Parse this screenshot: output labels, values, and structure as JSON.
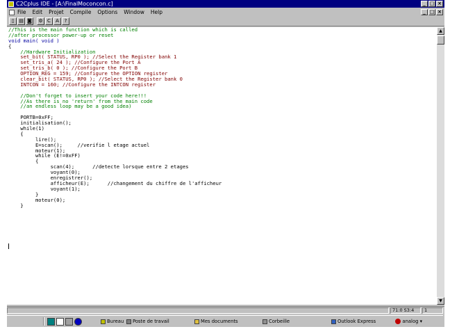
{
  "window": {
    "title": "C2Cplus IDE - [A:\\FinalMoconcon.c]",
    "controls": [
      "_",
      "□",
      "×"
    ]
  },
  "menubar": {
    "items": [
      "File",
      "Edit",
      "Projet",
      "Compile",
      "Options",
      "Window",
      "Help"
    ],
    "mdi_controls": [
      "_",
      "□",
      "×"
    ]
  },
  "toolbar": {
    "buttons": [
      "new",
      "open",
      "save",
      "compile",
      "C",
      "A",
      "?"
    ]
  },
  "editor": {
    "lines": [
      {
        "text": "//This is the main function which is called",
        "kind": "comment"
      },
      {
        "text": "//after processor power-up or reset",
        "kind": "comment"
      },
      {
        "text": "void main( void )",
        "kind": "keyword"
      },
      {
        "text": "{",
        "kind": "plain"
      },
      {
        "text": "    //Hardware Initialization",
        "kind": "comment"
      },
      {
        "text": "    set_bit( STATUS, RP0 ); //Select the Register bank 1",
        "kind": "code"
      },
      {
        "text": "    set_tris_a( 24 ); //Configure the Port A",
        "kind": "code"
      },
      {
        "text": "    set_tris_b( 0 ); //Configure the Port B",
        "kind": "code"
      },
      {
        "text": "    OPTION_REG = 159; //Configure the OPTION register",
        "kind": "code"
      },
      {
        "text": "    clear_bit( STATUS, RP0 ); //Select the Register bank 0",
        "kind": "code"
      },
      {
        "text": "    INTCON = 160; //Configure the INTCON register",
        "kind": "code"
      },
      {
        "text": "",
        "kind": "plain"
      },
      {
        "text": "    //Don't forget to insert your code here!!!",
        "kind": "comment"
      },
      {
        "text": "    //As there is no 'return' from the main code",
        "kind": "comment"
      },
      {
        "text": "    //an endless loop may be a good idea)",
        "kind": "comment"
      },
      {
        "text": "",
        "kind": "plain"
      },
      {
        "text": "    PORTB=0xFF;",
        "kind": "plain"
      },
      {
        "text": "    initialisation();",
        "kind": "plain"
      },
      {
        "text": "    while(1)",
        "kind": "plain"
      },
      {
        "text": "    {",
        "kind": "plain"
      },
      {
        "text": "         lire();",
        "kind": "plain"
      },
      {
        "text": "         E=scan();     //verifie l etage actuel",
        "kind": "plain"
      },
      {
        "text": "         moteur(1);",
        "kind": "plain"
      },
      {
        "text": "         while (E!=0xFF)",
        "kind": "plain"
      },
      {
        "text": "         {",
        "kind": "plain"
      },
      {
        "text": "              scan(4);      //detecte lorsque entre 2 etages",
        "kind": "plain"
      },
      {
        "text": "              voyant(0);",
        "kind": "plain"
      },
      {
        "text": "              enregistrer();",
        "kind": "plain"
      },
      {
        "text": "              afficheur(E);      //changement du chiffre de l'afficheur",
        "kind": "plain"
      },
      {
        "text": "              voyant(1);",
        "kind": "plain"
      },
      {
        "text": "         }",
        "kind": "plain"
      },
      {
        "text": "         moteur(0);",
        "kind": "plain"
      },
      {
        "text": "    }",
        "kind": "plain"
      }
    ]
  },
  "statusbar": {
    "position": "71:0 S3:4",
    "mode": "1"
  },
  "taskbar": {
    "tasks": [
      {
        "label": "Bureau",
        "icon": "desktop-icon"
      },
      {
        "label": "Poste de travail",
        "icon": "computer-icon"
      },
      {
        "label": "Mes documents",
        "icon": "folder-icon"
      },
      {
        "label": "Corbeille",
        "icon": "recycle-bin-icon"
      },
      {
        "label": "Outlook Express",
        "icon": "mail-icon"
      }
    ],
    "tray_label": "analog"
  },
  "colors": {
    "titlebar": "#000080",
    "comment": "#008000",
    "keyword": "#0000a0",
    "code": "#800000"
  }
}
